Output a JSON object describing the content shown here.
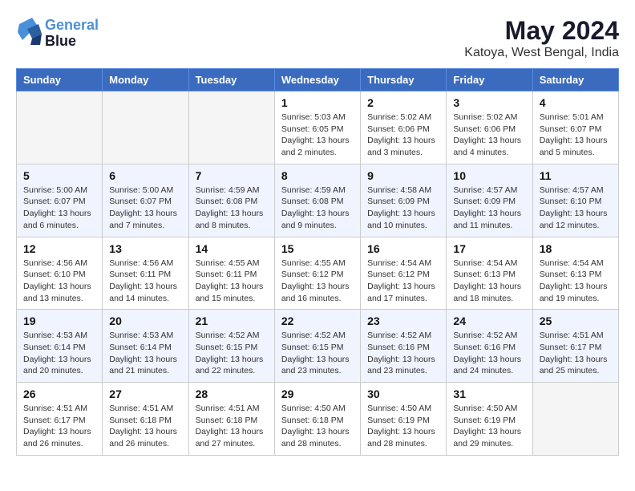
{
  "logo": {
    "line1": "General",
    "line2": "Blue"
  },
  "title": "May 2024",
  "subtitle": "Katoya, West Bengal, India",
  "weekdays": [
    "Sunday",
    "Monday",
    "Tuesday",
    "Wednesday",
    "Thursday",
    "Friday",
    "Saturday"
  ],
  "weeks": [
    [
      {
        "day": "",
        "sunrise": "",
        "sunset": "",
        "daylight": ""
      },
      {
        "day": "",
        "sunrise": "",
        "sunset": "",
        "daylight": ""
      },
      {
        "day": "",
        "sunrise": "",
        "sunset": "",
        "daylight": ""
      },
      {
        "day": "1",
        "sunrise": "Sunrise: 5:03 AM",
        "sunset": "Sunset: 6:05 PM",
        "daylight": "Daylight: 13 hours and 2 minutes."
      },
      {
        "day": "2",
        "sunrise": "Sunrise: 5:02 AM",
        "sunset": "Sunset: 6:06 PM",
        "daylight": "Daylight: 13 hours and 3 minutes."
      },
      {
        "day": "3",
        "sunrise": "Sunrise: 5:02 AM",
        "sunset": "Sunset: 6:06 PM",
        "daylight": "Daylight: 13 hours and 4 minutes."
      },
      {
        "day": "4",
        "sunrise": "Sunrise: 5:01 AM",
        "sunset": "Sunset: 6:07 PM",
        "daylight": "Daylight: 13 hours and 5 minutes."
      }
    ],
    [
      {
        "day": "5",
        "sunrise": "Sunrise: 5:00 AM",
        "sunset": "Sunset: 6:07 PM",
        "daylight": "Daylight: 13 hours and 6 minutes."
      },
      {
        "day": "6",
        "sunrise": "Sunrise: 5:00 AM",
        "sunset": "Sunset: 6:07 PM",
        "daylight": "Daylight: 13 hours and 7 minutes."
      },
      {
        "day": "7",
        "sunrise": "Sunrise: 4:59 AM",
        "sunset": "Sunset: 6:08 PM",
        "daylight": "Daylight: 13 hours and 8 minutes."
      },
      {
        "day": "8",
        "sunrise": "Sunrise: 4:59 AM",
        "sunset": "Sunset: 6:08 PM",
        "daylight": "Daylight: 13 hours and 9 minutes."
      },
      {
        "day": "9",
        "sunrise": "Sunrise: 4:58 AM",
        "sunset": "Sunset: 6:09 PM",
        "daylight": "Daylight: 13 hours and 10 minutes."
      },
      {
        "day": "10",
        "sunrise": "Sunrise: 4:57 AM",
        "sunset": "Sunset: 6:09 PM",
        "daylight": "Daylight: 13 hours and 11 minutes."
      },
      {
        "day": "11",
        "sunrise": "Sunrise: 4:57 AM",
        "sunset": "Sunset: 6:10 PM",
        "daylight": "Daylight: 13 hours and 12 minutes."
      }
    ],
    [
      {
        "day": "12",
        "sunrise": "Sunrise: 4:56 AM",
        "sunset": "Sunset: 6:10 PM",
        "daylight": "Daylight: 13 hours and 13 minutes."
      },
      {
        "day": "13",
        "sunrise": "Sunrise: 4:56 AM",
        "sunset": "Sunset: 6:11 PM",
        "daylight": "Daylight: 13 hours and 14 minutes."
      },
      {
        "day": "14",
        "sunrise": "Sunrise: 4:55 AM",
        "sunset": "Sunset: 6:11 PM",
        "daylight": "Daylight: 13 hours and 15 minutes."
      },
      {
        "day": "15",
        "sunrise": "Sunrise: 4:55 AM",
        "sunset": "Sunset: 6:12 PM",
        "daylight": "Daylight: 13 hours and 16 minutes."
      },
      {
        "day": "16",
        "sunrise": "Sunrise: 4:54 AM",
        "sunset": "Sunset: 6:12 PM",
        "daylight": "Daylight: 13 hours and 17 minutes."
      },
      {
        "day": "17",
        "sunrise": "Sunrise: 4:54 AM",
        "sunset": "Sunset: 6:13 PM",
        "daylight": "Daylight: 13 hours and 18 minutes."
      },
      {
        "day": "18",
        "sunrise": "Sunrise: 4:54 AM",
        "sunset": "Sunset: 6:13 PM",
        "daylight": "Daylight: 13 hours and 19 minutes."
      }
    ],
    [
      {
        "day": "19",
        "sunrise": "Sunrise: 4:53 AM",
        "sunset": "Sunset: 6:14 PM",
        "daylight": "Daylight: 13 hours and 20 minutes."
      },
      {
        "day": "20",
        "sunrise": "Sunrise: 4:53 AM",
        "sunset": "Sunset: 6:14 PM",
        "daylight": "Daylight: 13 hours and 21 minutes."
      },
      {
        "day": "21",
        "sunrise": "Sunrise: 4:52 AM",
        "sunset": "Sunset: 6:15 PM",
        "daylight": "Daylight: 13 hours and 22 minutes."
      },
      {
        "day": "22",
        "sunrise": "Sunrise: 4:52 AM",
        "sunset": "Sunset: 6:15 PM",
        "daylight": "Daylight: 13 hours and 23 minutes."
      },
      {
        "day": "23",
        "sunrise": "Sunrise: 4:52 AM",
        "sunset": "Sunset: 6:16 PM",
        "daylight": "Daylight: 13 hours and 23 minutes."
      },
      {
        "day": "24",
        "sunrise": "Sunrise: 4:52 AM",
        "sunset": "Sunset: 6:16 PM",
        "daylight": "Daylight: 13 hours and 24 minutes."
      },
      {
        "day": "25",
        "sunrise": "Sunrise: 4:51 AM",
        "sunset": "Sunset: 6:17 PM",
        "daylight": "Daylight: 13 hours and 25 minutes."
      }
    ],
    [
      {
        "day": "26",
        "sunrise": "Sunrise: 4:51 AM",
        "sunset": "Sunset: 6:17 PM",
        "daylight": "Daylight: 13 hours and 26 minutes."
      },
      {
        "day": "27",
        "sunrise": "Sunrise: 4:51 AM",
        "sunset": "Sunset: 6:18 PM",
        "daylight": "Daylight: 13 hours and 26 minutes."
      },
      {
        "day": "28",
        "sunrise": "Sunrise: 4:51 AM",
        "sunset": "Sunset: 6:18 PM",
        "daylight": "Daylight: 13 hours and 27 minutes."
      },
      {
        "day": "29",
        "sunrise": "Sunrise: 4:50 AM",
        "sunset": "Sunset: 6:18 PM",
        "daylight": "Daylight: 13 hours and 28 minutes."
      },
      {
        "day": "30",
        "sunrise": "Sunrise: 4:50 AM",
        "sunset": "Sunset: 6:19 PM",
        "daylight": "Daylight: 13 hours and 28 minutes."
      },
      {
        "day": "31",
        "sunrise": "Sunrise: 4:50 AM",
        "sunset": "Sunset: 6:19 PM",
        "daylight": "Daylight: 13 hours and 29 minutes."
      },
      {
        "day": "",
        "sunrise": "",
        "sunset": "",
        "daylight": ""
      }
    ]
  ]
}
